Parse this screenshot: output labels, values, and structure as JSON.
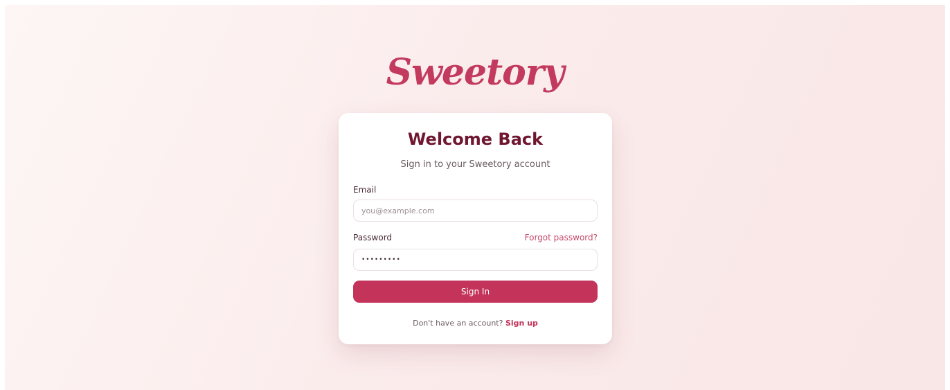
{
  "brand": {
    "logo_text": "Sweetory"
  },
  "login_card": {
    "title": "Welcome Back",
    "subtitle": "Sign in to your Sweetory account",
    "email": {
      "label": "Email",
      "placeholder": "you@example.com",
      "value": ""
    },
    "password": {
      "label": "Password",
      "value": "•••••••••",
      "forgot_link": "Forgot password?"
    },
    "submit_label": "Sign In",
    "signup_prompt": "Don't have an account?",
    "signup_link": "Sign up"
  },
  "colors": {
    "accent": "#c3335a",
    "title": "#6f1730",
    "background": "#fbecec"
  }
}
